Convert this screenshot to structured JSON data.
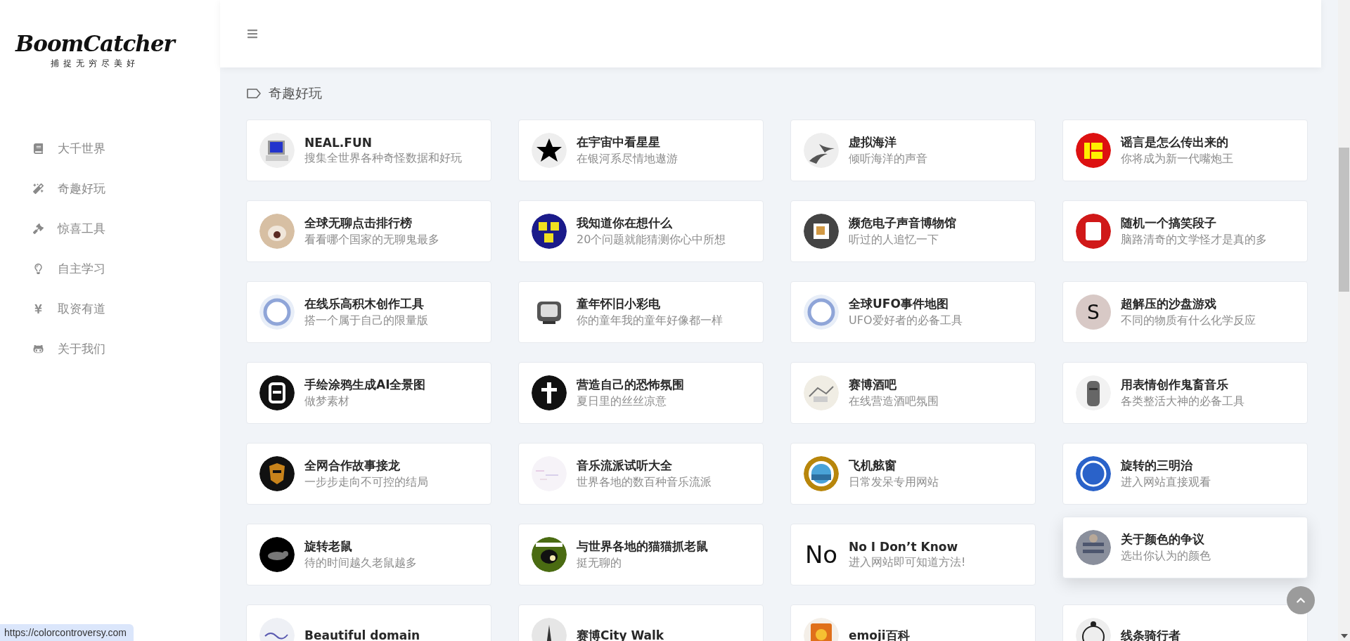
{
  "sidebar": {
    "logo": "BoomCatcher",
    "slogan": "捕捉无穷尽美好",
    "items": [
      {
        "label": "大千世界",
        "selected": false
      },
      {
        "label": "奇趣好玩",
        "selected": false
      },
      {
        "label": "惊喜工具",
        "selected": false
      },
      {
        "label": "自主学习",
        "selected": false
      },
      {
        "label": "取资有道",
        "selected": false
      },
      {
        "label": "关于我们",
        "selected": false
      }
    ]
  },
  "section": {
    "title": "奇趣好玩"
  },
  "cards": [
    {
      "title": "NEAL.FUN",
      "desc": "搜集全世界各种奇怪数据和好玩",
      "hovered": false
    },
    {
      "title": "在宇宙中看星星",
      "desc": "在银河系尽情地遨游",
      "hovered": false
    },
    {
      "title": "虚拟海洋",
      "desc": "倾听海洋的声音",
      "hovered": false
    },
    {
      "title": "谣言是怎么传出来的",
      "desc": "你将成为新一代嘴炮王",
      "hovered": false
    },
    {
      "title": "全球无聊点击排行榜",
      "desc": "看看哪个国家的无聊鬼最多",
      "hovered": false
    },
    {
      "title": "我知道你在想什么",
      "desc": "20个问题就能猜测你心中所想",
      "hovered": false
    },
    {
      "title": "濒危电子声音博物馆",
      "desc": "听过的人追忆一下",
      "hovered": false
    },
    {
      "title": "随机一个搞笑段子",
      "desc": "脑路清奇的文学怪才是真的多",
      "hovered": false
    },
    {
      "title": "在线乐高积木创作工具",
      "desc": "搭一个属于自己的限量版",
      "hovered": false
    },
    {
      "title": "童年怀旧小彩电",
      "desc": "你的童年我的童年好像都一样",
      "hovered": false
    },
    {
      "title": "全球UFO事件地图",
      "desc": "UFO爱好者的必备工具",
      "hovered": false
    },
    {
      "title": "超解压的沙盘游戏",
      "desc": "不同的物质有什么化学反应",
      "icon_text": "S",
      "hovered": false
    },
    {
      "title": "手绘涂鸦生成AI全景图",
      "desc": "做梦素材",
      "hovered": false
    },
    {
      "title": "营造自己的恐怖氛围",
      "desc": "夏日里的丝丝凉意",
      "hovered": false
    },
    {
      "title": "赛博酒吧",
      "desc": "在线营造酒吧氛围",
      "hovered": false
    },
    {
      "title": "用表情创作鬼畜音乐",
      "desc": "各类整活大神的必备工具",
      "hovered": false
    },
    {
      "title": "全网合作故事接龙",
      "desc": "一步步走向不可控的结局",
      "hovered": false
    },
    {
      "title": "音乐流派试听大全",
      "desc": "世界各地的数百种音乐流派",
      "hovered": false
    },
    {
      "title": "飞机舷窗",
      "desc": "日常发呆专用网站",
      "hovered": false
    },
    {
      "title": "旋转的三明治",
      "desc": "进入网站直接观看",
      "hovered": false
    },
    {
      "title": "旋转老鼠",
      "desc": "待的时间越久老鼠越多",
      "hovered": false
    },
    {
      "title": "与世界各地的猫猫抓老鼠",
      "desc": "挺无聊的",
      "hovered": false
    },
    {
      "title": "No I Don’t Know",
      "desc": "进入网站即可知道方法!",
      "icon_text": "No",
      "hovered": false
    },
    {
      "title": "关于颜色的争议",
      "desc": "选出你认为的颜色",
      "hovered": true
    },
    {
      "title": "Beautiful domain",
      "hovered": false
    },
    {
      "title": "赛博City Walk",
      "hovered": false
    },
    {
      "title": "emoji百科",
      "hovered": false
    },
    {
      "title": "线条骑行者",
      "hovered": false
    }
  ],
  "status_link": "https://colorcontroversy.com"
}
